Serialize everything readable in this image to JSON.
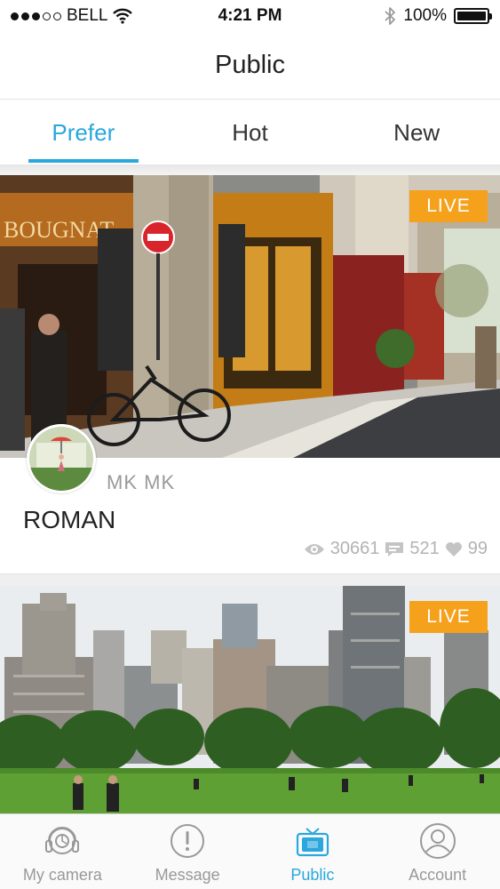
{
  "status_bar": {
    "carrier": "BELL",
    "time": "4:21 PM",
    "battery": "100%",
    "battery_level": 1.0
  },
  "header": {
    "title": "Public"
  },
  "tabs": [
    {
      "label": "Prefer",
      "active": true
    },
    {
      "label": "Hot",
      "active": false
    },
    {
      "label": "New",
      "active": false
    }
  ],
  "feed": [
    {
      "badge": "LIVE",
      "author": "MK MK",
      "title": "ROMAN",
      "views": "30661",
      "comments": "521",
      "likes": "99"
    },
    {
      "badge": "LIVE"
    }
  ],
  "bottom_nav": [
    {
      "label": "My camera",
      "icon": "camera-icon",
      "active": false
    },
    {
      "label": "Message",
      "icon": "alert-icon",
      "active": false
    },
    {
      "label": "Public",
      "icon": "tv-icon",
      "active": true
    },
    {
      "label": "Account",
      "icon": "user-icon",
      "active": false
    }
  ],
  "colors": {
    "accent": "#2aa7dd",
    "live": "#f5a11c",
    "muted": "#b3b3b3"
  }
}
